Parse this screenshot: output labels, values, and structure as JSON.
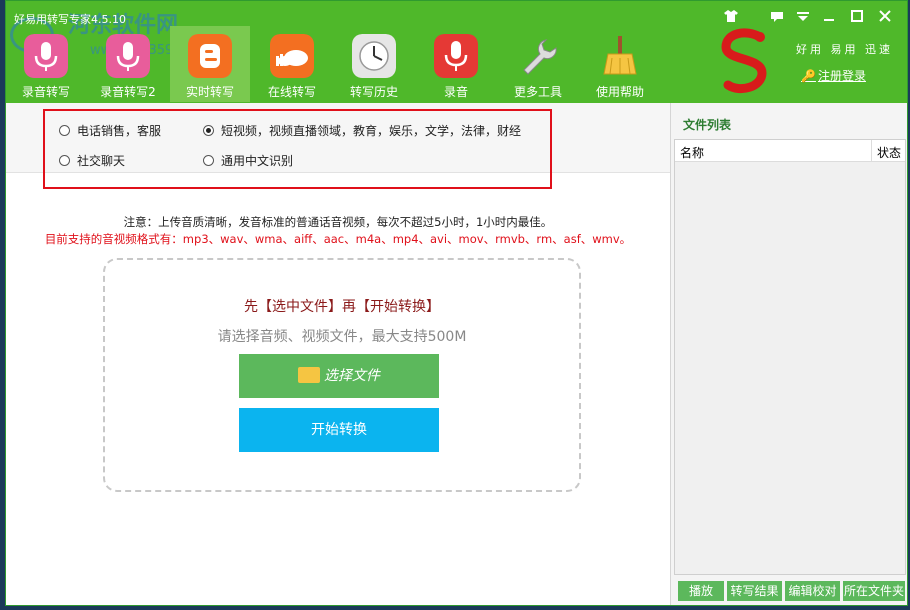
{
  "window": {
    "title": "好易用转写专家4.5.10",
    "watermark": {
      "site": "河东软件网",
      "url": "www.pc0359.cn"
    }
  },
  "tabs": [
    {
      "label": "录音转写",
      "icon": "microphone-pink-icon",
      "color": "#e85d9b"
    },
    {
      "label": "录音转写2",
      "icon": "microphone-pink-icon",
      "color": "#e85d9b"
    },
    {
      "label": "实时转写",
      "icon": "blogger-icon",
      "color": "#f36f21"
    },
    {
      "label": "在线转写",
      "icon": "cloud-icon",
      "color": "#f36f21"
    },
    {
      "label": "转写历史",
      "icon": "clock-icon",
      "color": "#eaeaea"
    },
    {
      "label": "录音",
      "icon": "microphone-red-icon",
      "color": "#e53935"
    },
    {
      "label": "更多工具",
      "icon": "wrench-icon",
      "color": "#d0d0d0"
    },
    {
      "label": "使用帮助",
      "icon": "broom-icon",
      "color": "#f5c542"
    }
  ],
  "brand": {
    "slogan": "好用 易用 迅速",
    "login_label": "注册登录"
  },
  "options": [
    {
      "label": "电话销售，客服",
      "checked": false
    },
    {
      "label": "短视频，视频直播领域，教育，娱乐，文学，法律，财经",
      "checked": true
    },
    {
      "label": "社交聊天",
      "checked": false
    },
    {
      "label": "通用中文识别",
      "checked": false
    }
  ],
  "notice": {
    "line1": "注意：上传音质清晰，发音标准的普通话音视频，每次不超过5小时，1小时内最佳。",
    "line2": "目前支持的音视频格式有：mp3、wav、wma、aiff、aac、m4a、mp4、avi、mov、rmvb、rm、asf、wmv。"
  },
  "dropzone": {
    "steps": "先【选中文件】再【开始转换】",
    "hint": "请选择音频、视频文件，最大支持500M",
    "choose_label": "选择文件",
    "start_label": "开始转换"
  },
  "file_list": {
    "title": "文件列表",
    "columns": [
      "名称",
      "状态"
    ],
    "buttons": [
      "播放",
      "转写结果",
      "编辑校对",
      "所在文件夹"
    ]
  }
}
